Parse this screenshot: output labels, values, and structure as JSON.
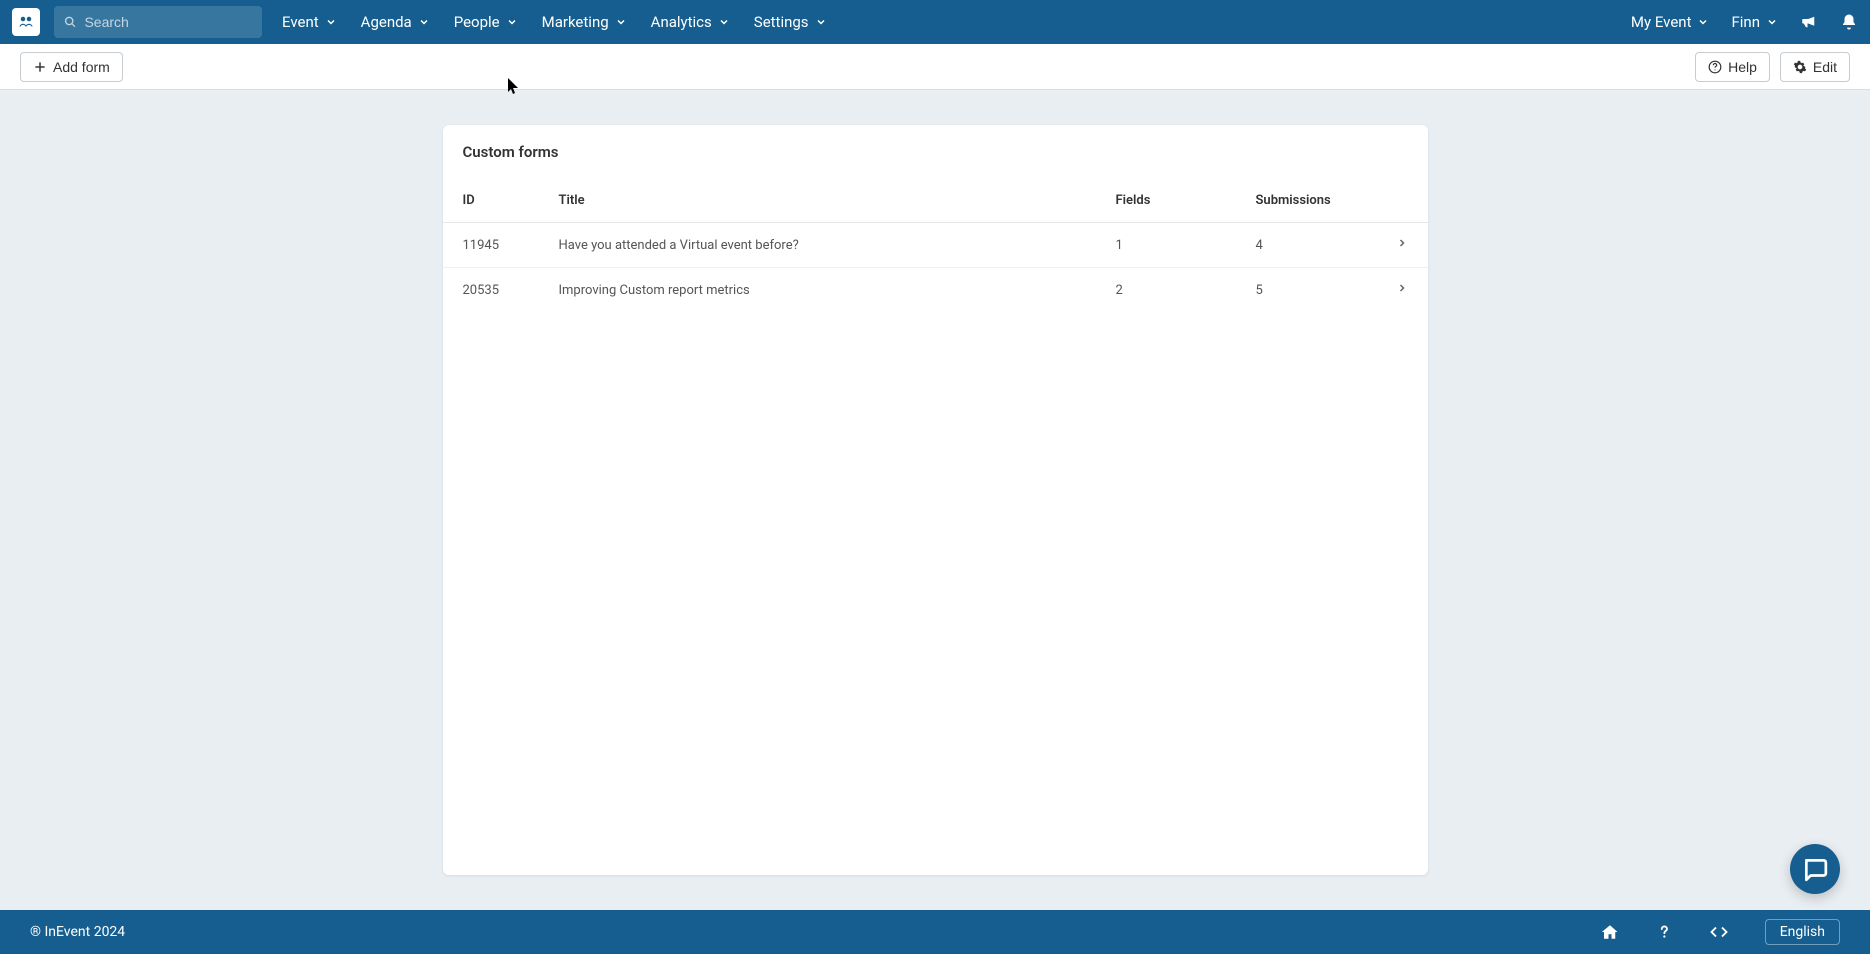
{
  "topnav": {
    "search_placeholder": "Search",
    "items": [
      "Event",
      "Agenda",
      "People",
      "Marketing",
      "Analytics",
      "Settings"
    ],
    "right": {
      "my_event": "My Event",
      "user": "Finn"
    }
  },
  "subnav": {
    "add_form": "Add form",
    "help": "Help",
    "edit": "Edit"
  },
  "card": {
    "title": "Custom forms",
    "columns": {
      "id": "ID",
      "title": "Title",
      "fields": "Fields",
      "submissions": "Submissions"
    },
    "rows": [
      {
        "id": "11945",
        "title": "Have you attended a Virtual event before?",
        "fields": "1",
        "submissions": "4"
      },
      {
        "id": "20535",
        "title": "Improving Custom report metrics",
        "fields": "2",
        "submissions": "5"
      }
    ]
  },
  "footer": {
    "copyright": "® InEvent 2024",
    "language": "English"
  }
}
